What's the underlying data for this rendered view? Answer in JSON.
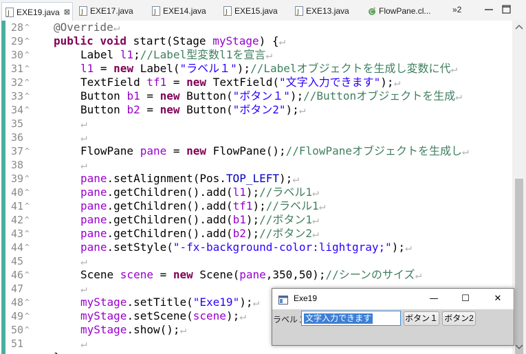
{
  "tabs": [
    {
      "label": "EXE19.java",
      "active": true,
      "close": "⊠"
    },
    {
      "label": "EXE17.java",
      "active": false
    },
    {
      "label": "EXE14.java",
      "active": false
    },
    {
      "label": "EXE15.java",
      "active": false
    },
    {
      "label": "EXE13.java",
      "active": false
    },
    {
      "label": "FlowPane.cl...",
      "active": false
    }
  ],
  "overflow": {
    "label": "»2"
  },
  "colors": {
    "keyword": "#7f0055",
    "field": "#9900cc",
    "comment": "#3f7f5f",
    "string": "#2a00ff",
    "change_bar": "#4aaf9f"
  },
  "code_lines": [
    {
      "num": "28",
      "fold": "^",
      "text": "@Override"
    },
    {
      "num": "29",
      "fold": "^",
      "text": "public void start(Stage myStage) {"
    },
    {
      "num": "30",
      "fold": "^",
      "text": "Label l1;//Label型変数l1を宣言"
    },
    {
      "num": "31",
      "fold": "^",
      "text": "l1 = new Label(\"ラベル１\");//Labelオブジェクトを生成し変数に代"
    },
    {
      "num": "32",
      "fold": "^",
      "text": "TextField tf1 = new TextField(\"文字入力できます\");"
    },
    {
      "num": "33",
      "fold": "^",
      "text": "Button b1 = new Button(\"ボタン１\");//Buttonオブジェクトを生成"
    },
    {
      "num": "34",
      "fold": "^",
      "text": "Button b2 = new Button(\"ボタン2\");"
    },
    {
      "num": "35",
      "fold": "",
      "text": ""
    },
    {
      "num": "36",
      "fold": "",
      "text": ""
    },
    {
      "num": "37",
      "fold": "^",
      "text": "FlowPane pane = new FlowPane();//FlowPaneオブジェクトを生成し"
    },
    {
      "num": "38",
      "fold": "",
      "text": ""
    },
    {
      "num": "39",
      "fold": "^",
      "text": "pane.setAlignment(Pos.TOP_LEFT);"
    },
    {
      "num": "40",
      "fold": "^",
      "text": "pane.getChildren().add(l1);//ラベル1"
    },
    {
      "num": "41",
      "fold": "^",
      "text": "pane.getChildren().add(tf1);//ラベル1"
    },
    {
      "num": "42",
      "fold": "^",
      "text": "pane.getChildren().add(b1);//ボタン1"
    },
    {
      "num": "43",
      "fold": "^",
      "text": "pane.getChildren().add(b2);//ボタン2"
    },
    {
      "num": "44",
      "fold": "^",
      "text": "pane.setStyle(\"-fx-background-color:lightgray;\");"
    },
    {
      "num": "45",
      "fold": "",
      "text": ""
    },
    {
      "num": "46",
      "fold": "^",
      "text": "Scene scene = new Scene(pane,350,50);//シーンのサイズ"
    },
    {
      "num": "47",
      "fold": "",
      "text": ""
    },
    {
      "num": "48",
      "fold": "^",
      "text": "myStage.setTitle(\"Exe19\");"
    },
    {
      "num": "49",
      "fold": "^",
      "text": "myStage.setScene(scene);"
    },
    {
      "num": "50",
      "fold": "^",
      "text": "myStage.show();"
    },
    {
      "num": "51",
      "fold": "",
      "text": ""
    },
    {
      "num": "",
      "fold": "",
      "text": "}"
    }
  ],
  "window": {
    "title": "Exe19",
    "minimize": "—",
    "maximize": "☐",
    "close": "✕",
    "label": "ラベル１",
    "textfield_value": "文字入力できます",
    "button1": "ボタン１",
    "button2": "ボタン2"
  }
}
